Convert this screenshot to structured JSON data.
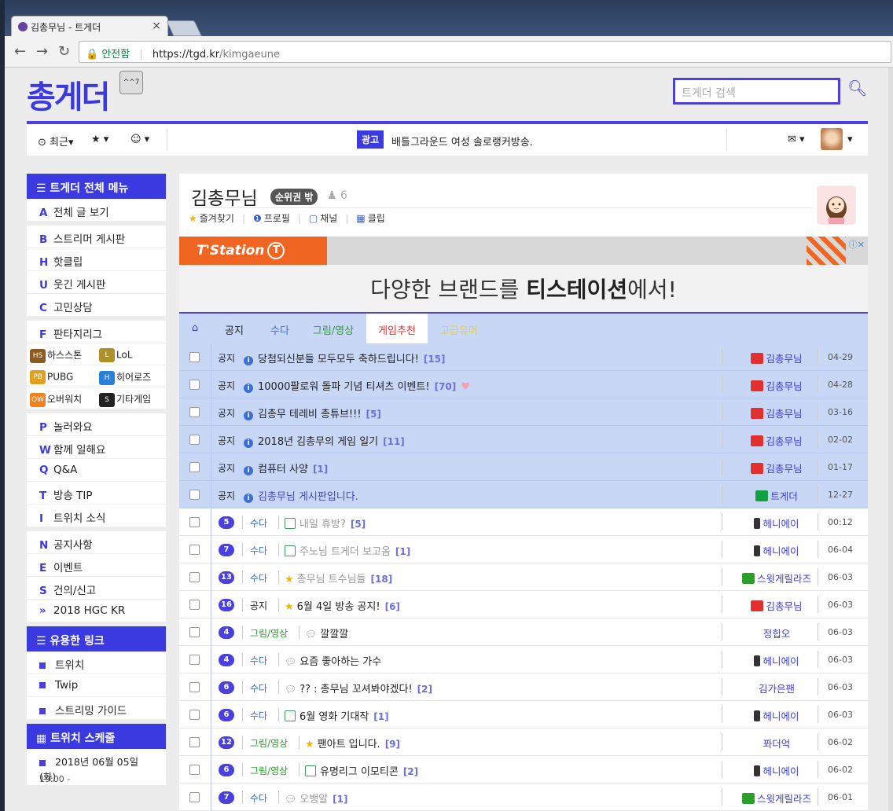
{
  "browser": {
    "tab_title": "김총무님 - 트게더",
    "tab_close": "×",
    "secure_label": "안전함",
    "url_host": "https://tgd.kr",
    "url_path": "/kimgaeune"
  },
  "site": {
    "logo": "총게더",
    "logo_badge": "^^7",
    "search_placeholder": "트게더 검색"
  },
  "topnav": {
    "recent": "⊙ 최근▾",
    "favorites": "★ ▾",
    "emoji": "☺ ▾",
    "ad_badge": "광고",
    "ad_text": "배틀그라운드 여성 솔로랭커방송.",
    "mail": "✉ ▾",
    "profile_caret": "▾"
  },
  "sidebar": {
    "menu_title": "☰ 트게더 전체 메뉴",
    "group1": [
      {
        "key": "A",
        "label": "전체 글 보기"
      }
    ],
    "group2": [
      {
        "key": "B",
        "label": "스트리머 게시판"
      },
      {
        "key": "H",
        "label": "핫클립"
      },
      {
        "key": "U",
        "label": "웃긴 게시판"
      },
      {
        "key": "C",
        "label": "고민상담"
      }
    ],
    "fantasy": {
      "key": "F",
      "label": "판타지리그"
    },
    "games": [
      {
        "label": "하스스톤",
        "color": "#8a5a20",
        "icon": "HS"
      },
      {
        "label": "LoL",
        "color": "#b0902a",
        "icon": "L"
      },
      {
        "label": "PUBG",
        "color": "#e0a020",
        "icon": "PB"
      },
      {
        "label": "히어로즈",
        "color": "#2a7fd8",
        "icon": "H"
      },
      {
        "label": "오버워치",
        "color": "#f08020",
        "icon": "OW"
      },
      {
        "label": "기타게임",
        "color": "#222222",
        "icon": "S"
      }
    ],
    "group3": [
      {
        "key": "P",
        "label": "놀러와요"
      },
      {
        "key": "W",
        "label": "함께 일해요"
      },
      {
        "key": "Q",
        "label": "Q&A"
      },
      {
        "key": "T",
        "label": "방송 TIP"
      },
      {
        "key": "I",
        "label": "트위치 소식"
      }
    ],
    "group4": [
      {
        "key": "N",
        "label": "공지사항"
      },
      {
        "key": "E",
        "label": "이벤트"
      },
      {
        "key": "S",
        "label": "건의/신고"
      },
      {
        "key": "»",
        "label": "2018 HGC KR"
      }
    ],
    "links_title": "☰ 유용한 링크",
    "links": [
      "트위치",
      "Twip",
      "스트리밍 가이드"
    ],
    "schedule_title": "▦ 트위치 스케줄",
    "schedule_date": "2018년 06월 05일 (화)",
    "schedule_time": "19:00 -"
  },
  "channel": {
    "name": "김총무님",
    "rank_badge": "순위권 밖",
    "followers": "6",
    "follower_icon": "♟",
    "links": [
      {
        "icon": "★",
        "label": "즐겨찾기"
      },
      {
        "icon": "❶",
        "label": "프로필"
      },
      {
        "icon": "▢",
        "label": "채널"
      },
      {
        "icon": "▦",
        "label": "클립"
      }
    ]
  },
  "banner": {
    "brand": "T'Station",
    "brand_mark": "T",
    "ad_choice": "ⓘ✕",
    "text_pre": "다양한 브랜드를 ",
    "text_bold": "티스테이션",
    "text_post": "에서!"
  },
  "board_tabs": [
    {
      "label": "⌂",
      "color": "#3a3ae0"
    },
    {
      "label": "공지",
      "color": "#222222"
    },
    {
      "label": "수다",
      "color": "#3a6fd8"
    },
    {
      "label": "그림/영상",
      "color": "#2aa02a"
    },
    {
      "label": "게임추천",
      "color": "#e03030",
      "active": true
    },
    {
      "label": "고급유머",
      "color": "#f2d020"
    }
  ],
  "posts": [
    {
      "notice": true,
      "cat": "공지",
      "title": "당첨되신분들 모두모두 축하드립니다!",
      "count": "[15]",
      "author": "김총무님",
      "author_icon": "tv",
      "date": "04-29",
      "icon": "info"
    },
    {
      "notice": true,
      "cat": "공지",
      "title": "10000팔로워 돌파 기념 티셔츠 이벤트!",
      "count": "[70]",
      "author": "김총무님",
      "author_icon": "tv",
      "date": "04-28",
      "icon": "info",
      "heart": "♥"
    },
    {
      "notice": true,
      "cat": "공지",
      "title": "김총무 테레비 총튜브!!!",
      "count": "[5]",
      "author": "김총무님",
      "author_icon": "tv",
      "date": "03-16",
      "icon": "info"
    },
    {
      "notice": true,
      "cat": "공지",
      "title": "2018년 김총무의 게임 일기",
      "count": "[11]",
      "author": "김총무님",
      "author_icon": "tv",
      "date": "02-02",
      "icon": "info"
    },
    {
      "notice": true,
      "cat": "공지",
      "title": "컴퓨터 사양",
      "count": "[1]",
      "author": "김총무님",
      "author_icon": "tv",
      "date": "01-17",
      "icon": "info"
    },
    {
      "notice": true,
      "cat": "공지",
      "title": "김총무님 게시판입니다.",
      "count": "",
      "author": "트게더",
      "author_icon": "tg",
      "date": "12-27",
      "icon": "info",
      "title_color": "#4a40c8"
    },
    {
      "num": "5",
      "cat": "수다",
      "cat_color": "#3a6fd8",
      "title": "내일 휴방?",
      "count": "[5]",
      "author": "헤니에이",
      "author_icon": "ph",
      "date": "00:12",
      "icon": "img",
      "title_color": "#999999"
    },
    {
      "num": "7",
      "cat": "수다",
      "cat_color": "#3a6fd8",
      "title": "주노님 트게더 보고옴",
      "count": "[1]",
      "author": "헤니에이",
      "author_icon": "ph",
      "date": "06-04",
      "icon": "img",
      "title_color": "#999999"
    },
    {
      "num": "13",
      "cat": "수다",
      "cat_color": "#3a6fd8",
      "title": "총무님 트수님들",
      "count": "[18]",
      "author": "스윗게릴라즈",
      "author_icon": "gr",
      "date": "06-03",
      "icon": "star",
      "title_color": "#999999"
    },
    {
      "num": "16",
      "cat": "공지",
      "cat_color": "#222222",
      "title": "6월 4일 방송 공지!",
      "count": "[6]",
      "author": "김총무님",
      "author_icon": "tv",
      "date": "06-03",
      "icon": "star"
    },
    {
      "num": "4",
      "cat": "그림/영상",
      "cat_color": "#2aa02a",
      "title": "깔깔깔",
      "count": "",
      "author": "정힙오",
      "author_icon": "",
      "date": "06-03",
      "icon": "chat"
    },
    {
      "num": "4",
      "cat": "수다",
      "cat_color": "#3a6fd8",
      "title": "요즘 좋아하는 가수",
      "count": "",
      "author": "헤니에이",
      "author_icon": "ph",
      "date": "06-03",
      "icon": "chat"
    },
    {
      "num": "6",
      "cat": "수다",
      "cat_color": "#3a6fd8",
      "title": "?? : 총무님 꼬셔봐야겠다!",
      "count": "[2]",
      "author": "김가은팬",
      "author_icon": "",
      "date": "06-03",
      "icon": "chat"
    },
    {
      "num": "6",
      "cat": "수다",
      "cat_color": "#3a6fd8",
      "title": "6월 영화 기대작",
      "count": "[1]",
      "author": "헤니에이",
      "author_icon": "ph",
      "date": "06-03",
      "icon": "img"
    },
    {
      "num": "12",
      "cat": "그림/영상",
      "cat_color": "#2aa02a",
      "title": "팬아트 입니다.",
      "count": "[9]",
      "author": "퐈더억",
      "author_icon": "",
      "date": "06-02",
      "icon": "star"
    },
    {
      "num": "6",
      "cat": "그림/영상",
      "cat_color": "#2aa02a",
      "title": "유명리그 이모티콘",
      "count": "[2]",
      "author": "헤니에이",
      "author_icon": "ph",
      "date": "06-02",
      "icon": "img"
    },
    {
      "num": "7",
      "cat": "수다",
      "cat_color": "#3a6fd8",
      "title": "오뱅알",
      "count": "[1]",
      "author": "스윗게릴라즈",
      "author_icon": "gr",
      "date": "06-01",
      "icon": "chat",
      "title_color": "#999999"
    }
  ]
}
